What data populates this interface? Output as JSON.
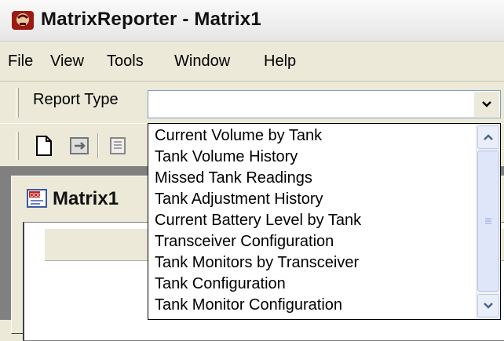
{
  "window": {
    "title": "MatrixReporter - Matrix1",
    "app_icon": "matrix-logo-icon"
  },
  "menubar": {
    "items": [
      "File",
      "View",
      "Tools",
      "Window",
      "Help"
    ]
  },
  "report_type": {
    "label": "Report Type",
    "value": ""
  },
  "toolbar": {
    "icons": [
      "new-document-icon",
      "export-icon",
      "report-icon"
    ]
  },
  "child_window": {
    "title": "Matrix1",
    "icon": "document-doc-icon"
  },
  "dropdown": {
    "options": [
      "Current Volume by Tank",
      "Tank Volume History",
      "Missed Tank Readings",
      "Tank Adjustment History",
      "Current Battery Level by Tank",
      "Transceiver Configuration",
      "Tank Monitors by Transceiver",
      "Tank Configuration",
      "Tank Monitor Configuration"
    ]
  }
}
